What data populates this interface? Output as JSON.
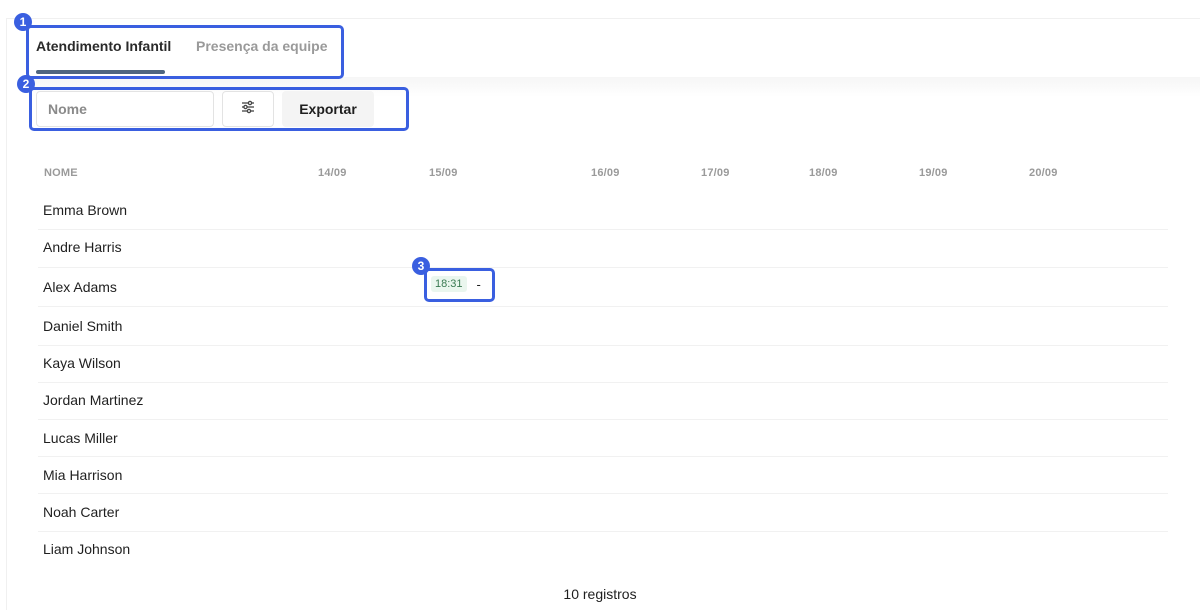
{
  "tabs": [
    {
      "label": "Atendimento Infantil",
      "active": true
    },
    {
      "label": "Presença da equipe",
      "active": false
    }
  ],
  "toolbar": {
    "search_placeholder": "Nome",
    "filter_icon": "sliders-icon",
    "export_label": "Exportar"
  },
  "table": {
    "name_header": "NOME",
    "dates": [
      "14/09",
      "15/09",
      "16/09",
      "17/09",
      "18/09",
      "19/09",
      "20/09"
    ],
    "rows": [
      {
        "name": "Emma Brown"
      },
      {
        "name": "Andre Harris"
      },
      {
        "name": "Alex Adams",
        "entry": {
          "date": "15/09",
          "checkin": "18:31",
          "checkout": "-"
        }
      },
      {
        "name": "Daniel Smith"
      },
      {
        "name": "Kaya Wilson"
      },
      {
        "name": "Jordan Martinez"
      },
      {
        "name": "Lucas Miller"
      },
      {
        "name": "Mia Harrison"
      },
      {
        "name": "Noah Carter"
      },
      {
        "name": "Liam Johnson"
      }
    ]
  },
  "footer": {
    "count_label": "10 registros"
  },
  "annotations": [
    "1",
    "2",
    "3"
  ],
  "colors": {
    "accent": "#4f6680",
    "annotation": "#3a5fe0",
    "badge_bg": "#eaf6ee",
    "badge_text": "#3a7a52"
  }
}
